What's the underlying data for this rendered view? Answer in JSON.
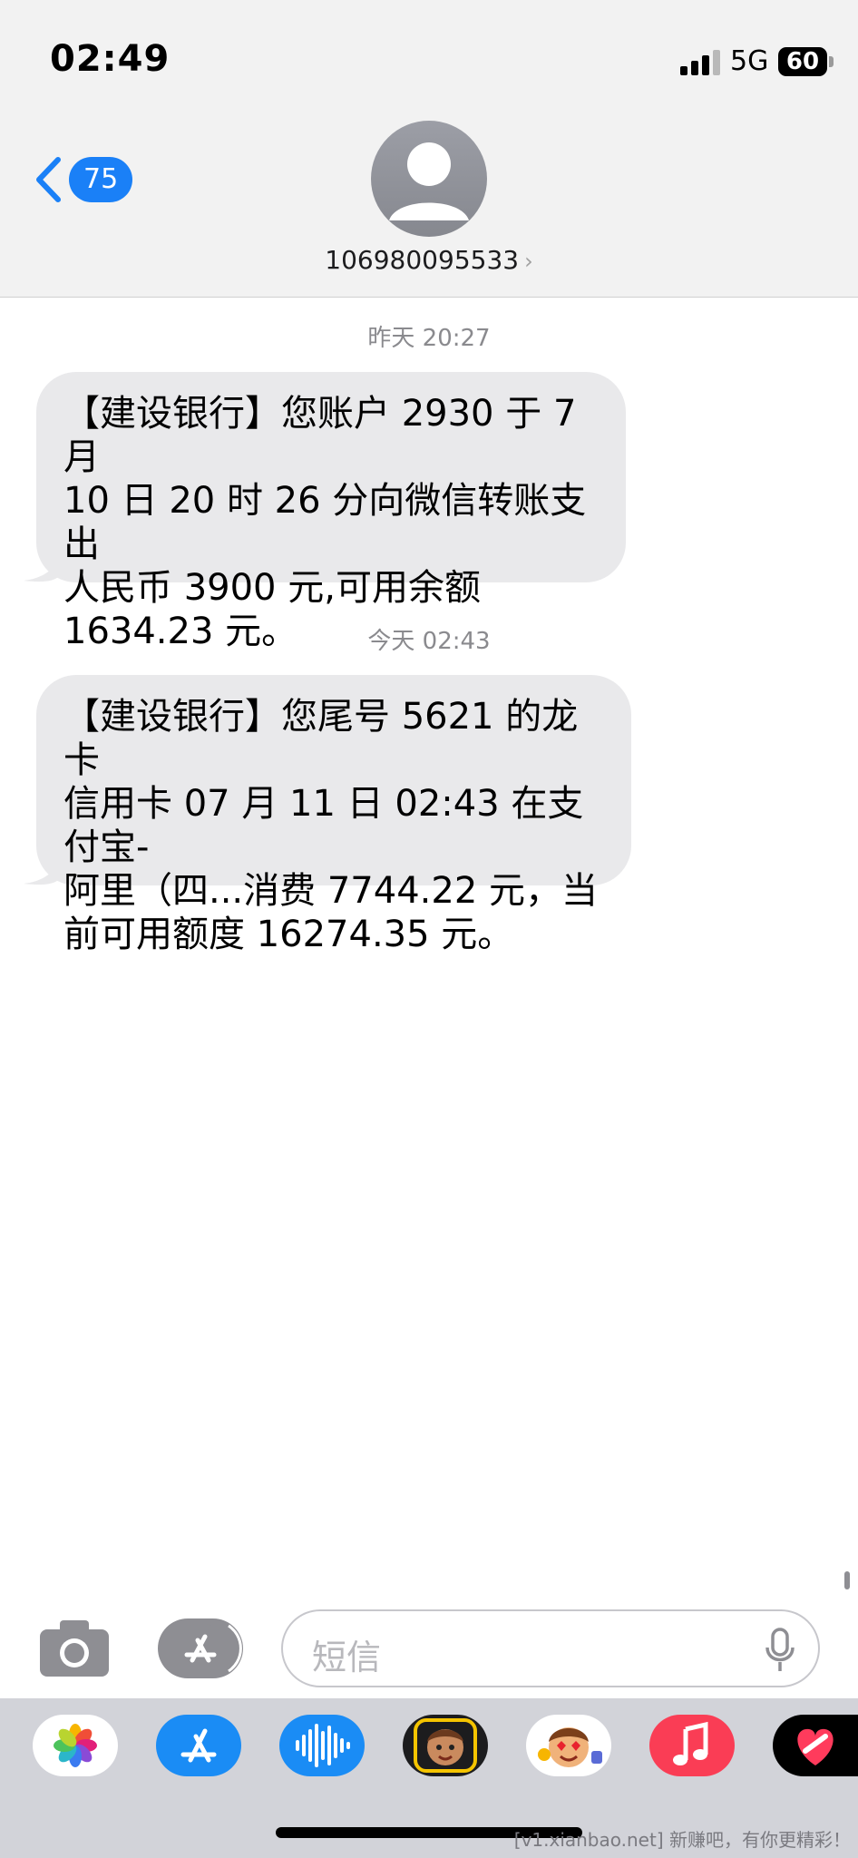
{
  "status_bar": {
    "time": "02:49",
    "network": "5G",
    "battery": "60"
  },
  "header": {
    "back_count": "75",
    "contact_number": "106980095533",
    "contact_chevron": "›"
  },
  "messages": [
    {
      "timestamp": "昨天 20:27",
      "lines": [
        "【建设银行】您账户 2930 于 7 月",
        "10 日 20 时 26 分向微信转账支出",
        "人民币 3900 元,可用余额",
        "1634.23 元。"
      ]
    },
    {
      "timestamp": "今天 02:43",
      "lines": [
        "【建设银行】您尾号 5621 的龙卡",
        "信用卡 07 月 11 日 02:43 在支付宝-",
        "阿里（四...消费 7744.22 元，当",
        "前可用额度 16274.35 元。"
      ]
    }
  ],
  "input": {
    "placeholder": "短信"
  },
  "app_strip": {
    "apps": [
      "photos-app",
      "app-store-app",
      "audio-message-app",
      "memoji-app",
      "animoji-stickers-app",
      "music-app",
      "digital-touch-app"
    ]
  },
  "watermark": "[v1.xianbao.net] 新赚吧，有你更精彩！",
  "colors": {
    "accent": "#1a80f7",
    "bubble": "#e9e9eb",
    "header_bg": "#f2f2f2",
    "app_strip_bg": "#d2d3d9"
  }
}
